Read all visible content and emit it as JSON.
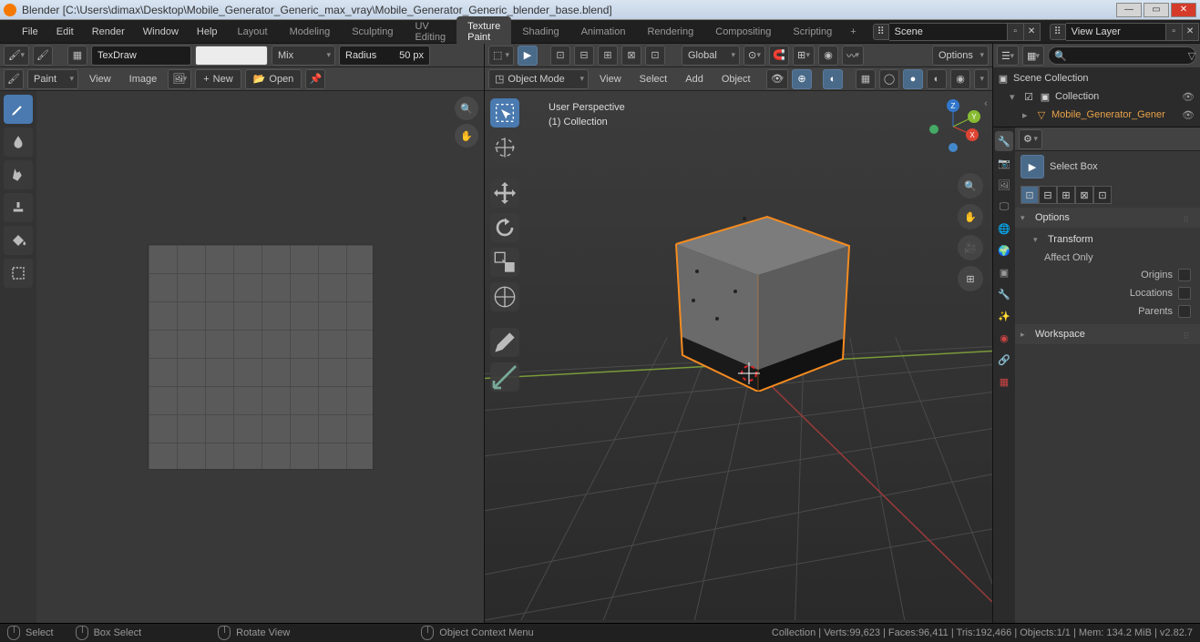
{
  "titlebar": {
    "app": "Blender",
    "filepath": "[C:\\Users\\dimax\\Desktop\\Mobile_Generator_Generic_max_vray\\Mobile_Generator_Generic_blender_base.blend]"
  },
  "menu": {
    "file": "File",
    "edit": "Edit",
    "render": "Render",
    "window": "Window",
    "help": "Help"
  },
  "tabs": {
    "layout": "Layout",
    "modeling": "Modeling",
    "sculpting": "Sculpting",
    "uv": "UV Editing",
    "texpaint": "Texture Paint",
    "shading": "Shading",
    "animation": "Animation",
    "rendering": "Rendering",
    "compositing": "Compositing",
    "scripting": "Scripting"
  },
  "scene": {
    "label": "Scene",
    "viewlayer": "View Layer"
  },
  "image_editor": {
    "brush_name": "TexDraw",
    "blend_mode": "Mix",
    "radius_label": "Radius",
    "radius_value": "50 px",
    "paint_menu": "Paint",
    "view": "View",
    "image": "Image",
    "new": "New",
    "open": "Open"
  },
  "viewport": {
    "mode": "Object Mode",
    "view": "View",
    "select": "Select",
    "add": "Add",
    "object": "Object",
    "orientation": "Global",
    "options": "Options",
    "overlay_line1": "User Perspective",
    "overlay_line2": "(1) Collection"
  },
  "outliner": {
    "scene_collection": "Scene Collection",
    "collection": "Collection",
    "object": "Mobile_Generator_Gener"
  },
  "properties": {
    "active_tool": "Select Box",
    "options": "Options",
    "transform": "Transform",
    "affect_only": "Affect Only",
    "origins": "Origins",
    "locations": "Locations",
    "parents": "Parents",
    "workspace": "Workspace"
  },
  "statusbar": {
    "select": "Select",
    "box_select": "Box Select",
    "rotate_view": "Rotate View",
    "context_menu": "Object Context Menu",
    "stats": "Collection | Verts:99,623 | Faces:96,411 | Tris:192,466 | Objects:1/1 | Mem: 134.2 MiB | v2.82.7"
  }
}
